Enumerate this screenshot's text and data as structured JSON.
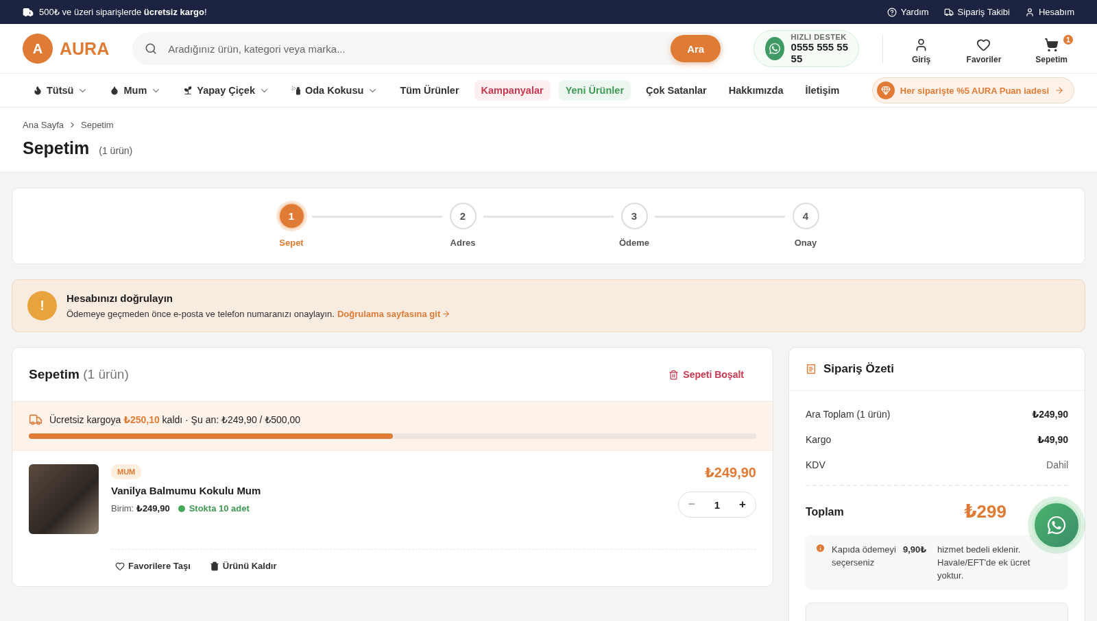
{
  "topbar": {
    "promo": "500₺ ve üzeri siparişlerde **ücretsiz kargo**!",
    "links": [
      {
        "kind": "help",
        "label": "Yardım"
      },
      {
        "kind": "truck",
        "label": "Sipariş Takibi"
      },
      {
        "kind": "user",
        "label": "Hesabım"
      }
    ]
  },
  "header": {
    "logo": {
      "letter": "A",
      "name": "AURA"
    },
    "search": {
      "placeholder": "Aradığınız ürün, kategori veya marka...",
      "button": "Ara"
    },
    "support": {
      "label": "HIZLI DESTEK",
      "phone": "0555 555 55 55"
    },
    "actions": [
      {
        "kind": "user",
        "label": "Giriş"
      },
      {
        "kind": "heart",
        "label": "Favoriler"
      },
      {
        "kind": "cart",
        "label": "Sepetim",
        "badge": "1"
      }
    ]
  },
  "nav": {
    "items": [
      {
        "kind": "dropdown",
        "label": "Tütsü"
      },
      {
        "kind": "dropdown",
        "label": "Mum"
      },
      {
        "kind": "dropdown",
        "label": "Yapay Çiçek"
      },
      {
        "kind": "dropdown",
        "label": "Oda Kokusu"
      },
      {
        "kind": "link",
        "label": "Tüm Ürünler"
      },
      {
        "kind": "sale",
        "label": "Kampanyalar"
      },
      {
        "kind": "new",
        "label": "Yeni Ürünler"
      },
      {
        "kind": "link",
        "label": "Çok Satanlar"
      },
      {
        "kind": "link",
        "label": "Hakkımızda"
      },
      {
        "kind": "link",
        "label": "İletişim"
      }
    ],
    "promo": "Her siparişte %5 AURA Puan iadesi"
  },
  "breadcrumb": [
    "Ana Sayfa",
    "Sepetim"
  ],
  "page": {
    "title": "Sepetim",
    "count": "(1 ürün)"
  },
  "steps": [
    {
      "number": "1",
      "label": "Sepet",
      "selected": true
    },
    {
      "number": "2",
      "label": "Adres",
      "selected": false
    },
    {
      "number": "3",
      "label": "Ödeme",
      "selected": false
    },
    {
      "number": "4",
      "label": "Onay",
      "selected": false
    }
  ],
  "alert": {
    "icon": "!",
    "title": "Hesabınızı doğrulayın",
    "text": "Ödemeye geçmeden önce e-posta ve telefon numaranızı onaylayın.",
    "link": "Doğrulama sayfasına git"
  },
  "cart": {
    "title": "Sepetim",
    "count": "(1 ürün)",
    "clear": "Sepeti Boşalt",
    "shipping": {
      "text": "Ücretsiz kargoya **₺250,10** kaldı · Şu an: ₺249,90 / ₺500,00",
      "level": 0.5
    },
    "items": [
      {
        "category": "MUM",
        "name": "Vanilya Balmumu Kokulu Mum",
        "unit_label": "Birim:",
        "unit_price": "₺249,90",
        "stock": "Stokta 10 adet",
        "in_stock": true,
        "price": "₺249,90",
        "minus": "−",
        "quantity": "1",
        "plus": "+",
        "favorite": "Favorilere Taşı",
        "remove": "Ürünü Kaldır"
      }
    ]
  },
  "summary": {
    "title": "Sipariş Özeti",
    "rows": [
      {
        "kind": "strong",
        "label": "Ara Toplam (1 ürün)",
        "value": "₺249,90"
      },
      {
        "kind": "strong",
        "label": "Kargo",
        "value": "₺49,90"
      },
      {
        "kind": "muted",
        "label": "KDV",
        "value": "Dahil"
      }
    ],
    "total": {
      "label": "Toplam",
      "value": "₺299"
    },
    "note": {
      "before": "Kapıda ödemeyi seçerseniz",
      "amount": "9,90₺",
      "after": "hizmet bedeli eklenir. Havale/EFT'de ek ücret yoktur."
    }
  }
}
